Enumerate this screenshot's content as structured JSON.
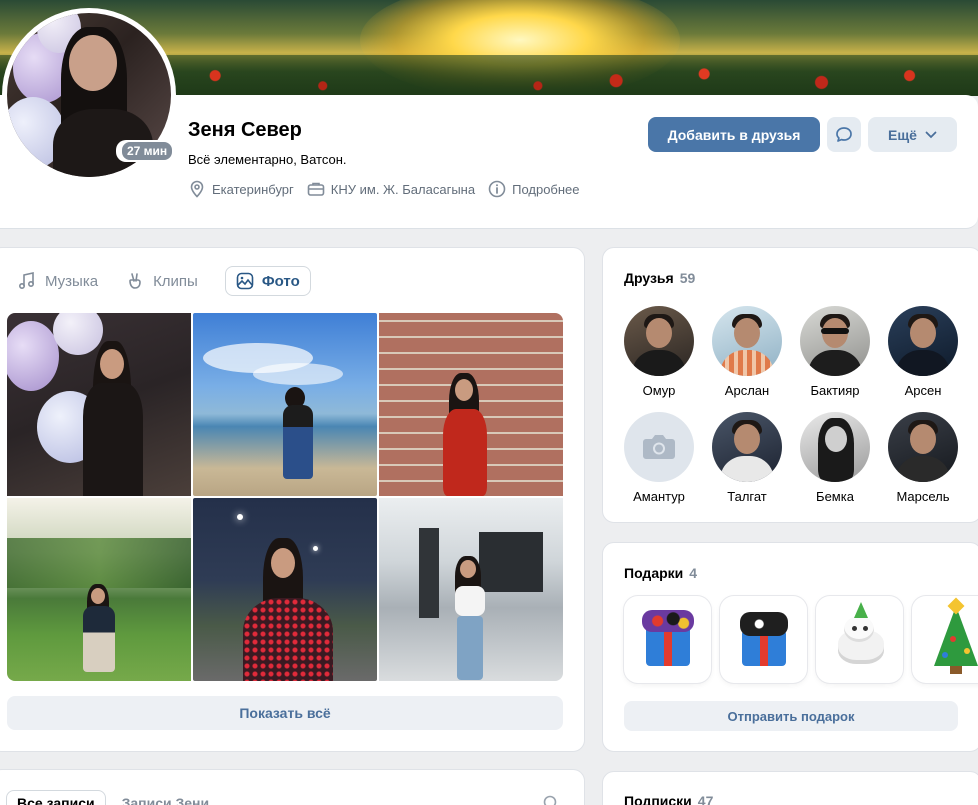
{
  "profile": {
    "name": "Зеня Север",
    "status": "Всё элементарно, Ватсон.",
    "online": "27 мин",
    "city": "Екатеринбург",
    "university": "КНУ им. Ж. Баласагына",
    "details": "Подробнее"
  },
  "actions": {
    "add_friend": "Добавить в друзья",
    "more": "Ещё"
  },
  "media_tabs": [
    {
      "label": "Музыка",
      "icon": "music-note-icon"
    },
    {
      "label": "Клипы",
      "icon": "clips-hand-icon"
    },
    {
      "label": "Фото",
      "icon": "photo-icon",
      "active": true
    }
  ],
  "photos": {
    "show_all": "Показать всё"
  },
  "friends": {
    "title": "Друзья",
    "count": "59",
    "items": [
      {
        "name": "Омур"
      },
      {
        "name": "Арслан"
      },
      {
        "name": "Бактияр"
      },
      {
        "name": "Арсен"
      },
      {
        "name": "Амантур"
      },
      {
        "name": "Талгат"
      },
      {
        "name": "Бемка"
      },
      {
        "name": "Марсель"
      }
    ]
  },
  "gifts": {
    "title": "Подарки",
    "count": "4",
    "send": "Отправить подарок"
  },
  "subscriptions": {
    "title": "Подписки",
    "count": "47"
  },
  "wall": {
    "tab_all": "Все записи",
    "tab_own": "Записи Зени"
  },
  "colors": {
    "accent": "#4a76a8",
    "link": "#2a5885",
    "secondary_text": "#818c99",
    "background": "#edeef0"
  }
}
